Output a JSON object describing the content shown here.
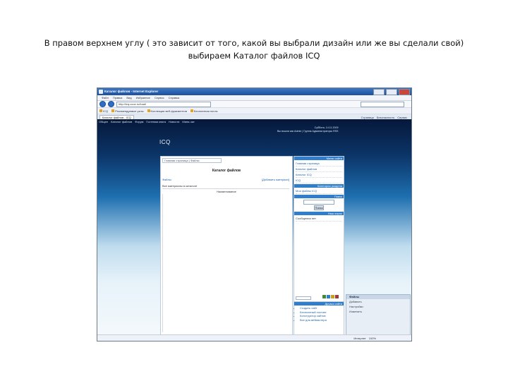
{
  "caption": {
    "line1": "В правом верхнем углу ( это зависит от того, какой вы выбрали дизайн или же вы сделали свой)",
    "line2": "выбираем Каталог файлов ICQ"
  },
  "browser": {
    "title": "Каталог файлов - Internet Explorer",
    "menu": [
      "Файл",
      "Правка",
      "Вид",
      "Избранное",
      "Сервис",
      "Справка"
    ],
    "address": "http://icq.ucoz.ru/load/",
    "favorites": [
      "ICQ",
      "Рекомендуемые узлы",
      "Коллекция веб-фрагментов",
      "Бесплатная почта"
    ],
    "tab": "Каталог файлов - ICQ",
    "commands": [
      "Страница",
      "Безопасность",
      "Сервис"
    ],
    "status": "Интернет",
    "zoom": "100%"
  },
  "site": {
    "nav": [
      "Общее",
      "Каталог файлов",
      "Форум",
      "Гостевая книга",
      "Новости",
      "Мини-чат"
    ],
    "logo": "ICQ",
    "user_line1": "Суббота, 14.11.2009",
    "user_line2": "Вы вошли как Admin | Группа Администраторы RSS",
    "breadcrumb": "Главная страница | Файлы",
    "catalog_title": "Каталог файлов",
    "files_label": "Файлы",
    "add_material": "[Добавить материал]",
    "all_materials": "Все материалы в каталоге",
    "column_header": "Наименование",
    "blocks": [
      {
        "header": "Меню сайта",
        "items": [
          "Главная страница",
          "Каталог файлов",
          "Каталог ICQ",
          "ICQ"
        ]
      },
      {
        "header": "Категории раздела",
        "items": [
          "Мои файлы ICQ"
        ]
      },
      {
        "header": "Поиск",
        "items": []
      },
      {
        "header": "Наш опрос",
        "items": [
          "Сообщения нет"
        ]
      }
    ],
    "search_button": "Поиск",
    "where_block": {
      "header": "Друзья сайта",
      "items": [
        "Создать сайт",
        "Бесплатный хостинг",
        "Конструктор сайтов",
        "Все для вебмастера"
      ]
    },
    "popup": {
      "header": "Файлы",
      "items": [
        "Добавить",
        "Настройки",
        "Изменить"
      ]
    }
  }
}
